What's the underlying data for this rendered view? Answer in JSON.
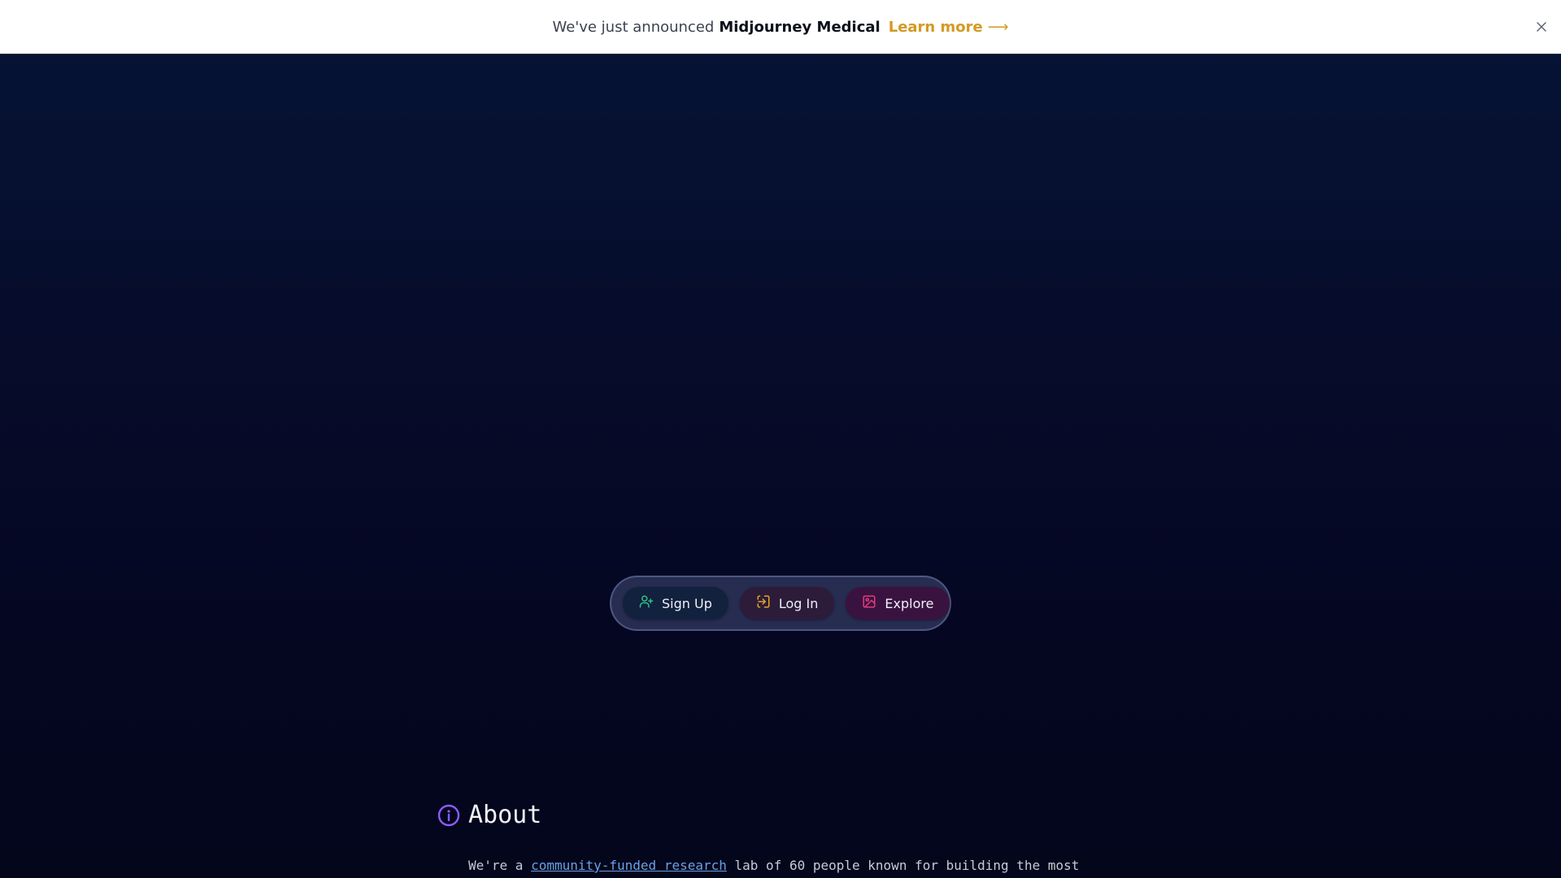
{
  "announcement": {
    "lead": "We've just announced",
    "product": "Midjourney Medical",
    "link_label": "Learn more",
    "link_arrow": "⟶",
    "close_icon": "close-icon"
  },
  "actions": {
    "signup": {
      "label": "Sign Up",
      "icon": "user-plus-icon",
      "color": "#2fbf8a"
    },
    "login": {
      "label": "Log In",
      "icon": "login-icon",
      "color": "#e6a420"
    },
    "explore": {
      "label": "Explore",
      "icon": "image-icon",
      "color": "#e23a7a"
    }
  },
  "about": {
    "heading": "About",
    "icon": "info-icon",
    "icon_color": "#8b5cf6",
    "text_before": "We're a ",
    "link_text": "community-funded research",
    "text_after": " lab of 60 people known for building the most"
  },
  "colors": {
    "link": "#6aa0e6",
    "accent_gold": "#d39a23",
    "background": "#050722"
  }
}
